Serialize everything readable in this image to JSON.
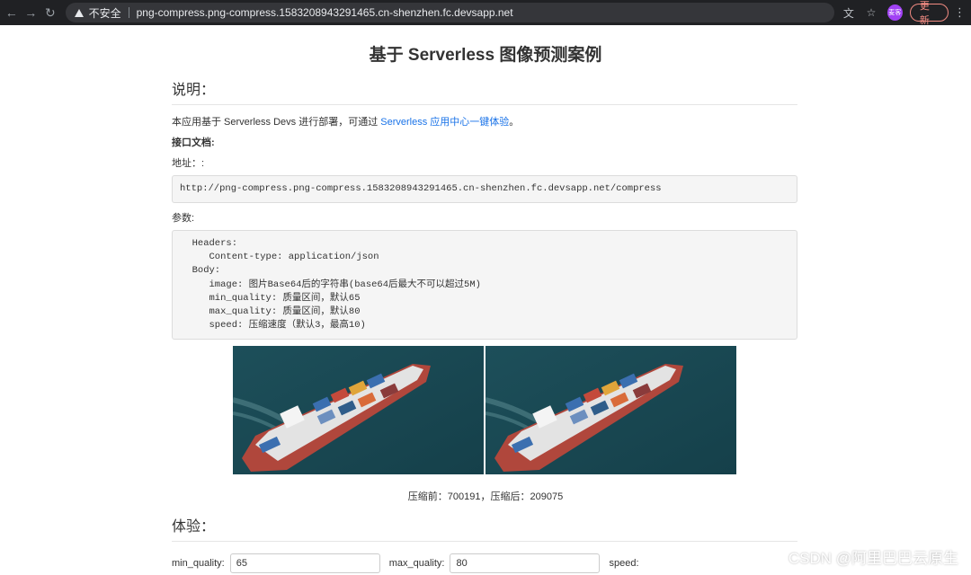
{
  "browser": {
    "security_label": "不安全",
    "url": "png-compress.png-compress.1583208943291465.cn-shenzhen.fc.devsapp.net",
    "update_label": "更新",
    "avatar_text": "麦客"
  },
  "page": {
    "title": "基于 Serverless 图像预测案例",
    "section_description": "说明：",
    "intro_prefix": "本应用基于 Serverless Devs 进行部署，可通过 ",
    "intro_link": "Serverless 应用中心一键体验",
    "intro_suffix": "。",
    "api_docs_label": "接口文档:",
    "address_label": "地址：:",
    "address_value": "http://png-compress.png-compress.1583208943291465.cn-shenzhen.fc.devsapp.net/compress",
    "params_label": "参数:",
    "params_lines": [
      "  Headers:",
      "     Content-type: application/json",
      "  Body:",
      "     image: 图片Base64后的字符串(base64后最大不可以超过5M)",
      "     min_quality: 质量区间，默认65",
      "     max_quality: 质量区间，默认80",
      "     speed: 压缩速度（默认3，最高10)"
    ],
    "compression_caption": "压缩前：700191，压缩后：209075",
    "section_experience": "体验：",
    "form": {
      "min_quality_label": "min_quality:",
      "min_quality_value": "65",
      "max_quality_label": "max_quality:",
      "max_quality_value": "80",
      "speed_label": "speed:"
    }
  },
  "watermark": "CSDN @阿里巴巴云原生",
  "colors": {
    "link": "#1a73e8",
    "chrome_bg": "#202124",
    "update_accent": "#f28b82",
    "code_bg": "#f5f5f5"
  }
}
